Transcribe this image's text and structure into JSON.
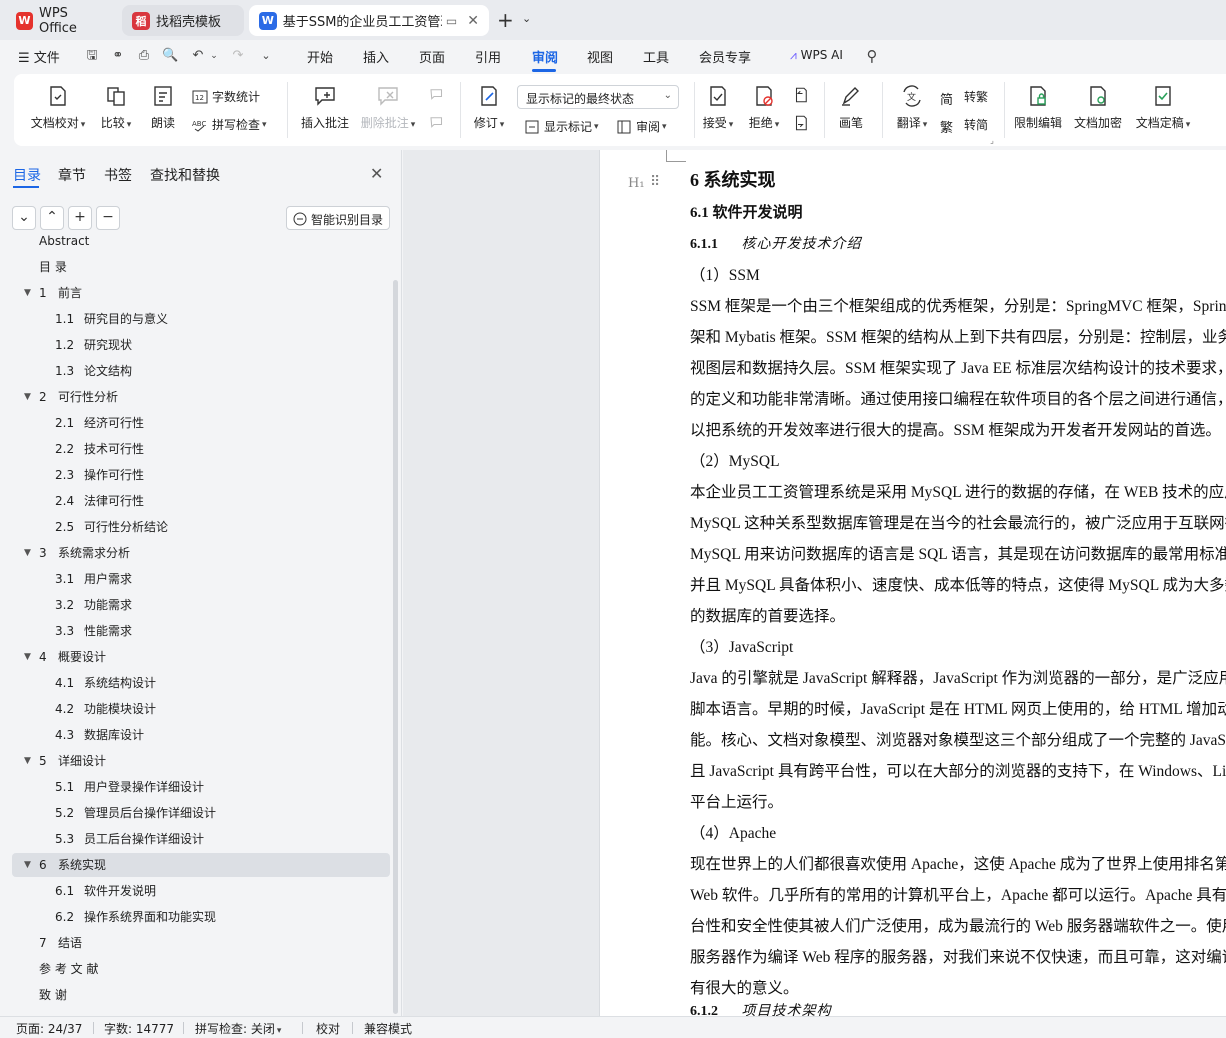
{
  "tabs": {
    "wps_office": "WPS Office",
    "template": "找稻壳模板",
    "document": "基于SSM的企业员工工资管理系统"
  },
  "menu": {
    "file": "文件",
    "items": [
      "开始",
      "插入",
      "页面",
      "引用",
      "审阅",
      "视图",
      "工具",
      "会员专享"
    ],
    "active": "审阅",
    "wps_ai": "WPS AI"
  },
  "ribbon": {
    "doc_check": "文档校对",
    "compare": "比较",
    "read_aloud": "朗读",
    "word_count": "字数统计",
    "spell_check": "拼写检查",
    "insert_comment": "插入批注",
    "delete_comment": "删除批注",
    "track_changes": "修订",
    "markup_state": "显示标记的最终状态",
    "show_markup": "显示标记",
    "review_pane": "审阅",
    "accept": "接受",
    "reject": "拒绝",
    "pen": "画笔",
    "translate": "翻译",
    "to_traditional": "转繁",
    "to_simplified": "转简",
    "restrict_edit": "限制编辑",
    "encrypt": "文档加密",
    "finalize": "文档定稿"
  },
  "nav": {
    "tabs": [
      "目录",
      "章节",
      "书签",
      "查找和替换"
    ],
    "smart_toc": "智能识别目录",
    "toc": [
      {
        "num": "",
        "text": "Abstract",
        "level": 0
      },
      {
        "num": "",
        "text": "目        录",
        "level": 0
      },
      {
        "num": "1",
        "text": "前言",
        "level": 1
      },
      {
        "num": "1.1",
        "text": "研究目的与意义",
        "level": 2
      },
      {
        "num": "1.2",
        "text": "研究现状",
        "level": 2
      },
      {
        "num": "1.3",
        "text": "论文结构",
        "level": 2
      },
      {
        "num": "2",
        "text": "可行性分析",
        "level": 1
      },
      {
        "num": "2.1",
        "text": "经济可行性",
        "level": 2
      },
      {
        "num": "2.2",
        "text": "技术可行性",
        "level": 2
      },
      {
        "num": "2.3",
        "text": "操作可行性",
        "level": 2
      },
      {
        "num": "2.4",
        "text": "法律可行性",
        "level": 2
      },
      {
        "num": "2.5",
        "text": "可行性分析结论",
        "level": 2
      },
      {
        "num": "3",
        "text": "系统需求分析",
        "level": 1
      },
      {
        "num": "3.1",
        "text": "用户需求",
        "level": 2
      },
      {
        "num": "3.2",
        "text": "功能需求",
        "level": 2
      },
      {
        "num": "3.3",
        "text": "性能需求",
        "level": 2
      },
      {
        "num": "4",
        "text": "概要设计",
        "level": 1
      },
      {
        "num": "4.1",
        "text": "系统结构设计",
        "level": 2
      },
      {
        "num": "4.2",
        "text": "功能模块设计",
        "level": 2
      },
      {
        "num": "4.3",
        "text": "数据库设计",
        "level": 2
      },
      {
        "num": "5",
        "text": "详细设计",
        "level": 1
      },
      {
        "num": "5.1",
        "text": "用户登录操作详细设计",
        "level": 2
      },
      {
        "num": "5.2",
        "text": "管理员后台操作详细设计",
        "level": 2
      },
      {
        "num": "5.3",
        "text": "员工后台操作详细设计",
        "level": 2
      },
      {
        "num": "6",
        "text": "系统实现",
        "level": 1,
        "selected": true
      },
      {
        "num": "6.1",
        "text": "软件开发说明",
        "level": 2
      },
      {
        "num": "6.2",
        "text": "操作系统界面和功能实现",
        "level": 2
      },
      {
        "num": "7",
        "text": "结语",
        "level": 0
      },
      {
        "num": "",
        "text": "参  考  文  献",
        "level": 0
      },
      {
        "num": "",
        "text": "致          谢",
        "level": 0
      }
    ]
  },
  "document": {
    "h1": "6     系统实现",
    "h2": "6.1     软件开发说明",
    "h3_num": "6.1.1",
    "h3_text": "核心开发技术介绍",
    "lines": [
      {
        "type": "sub",
        "text": "（1）SSM"
      },
      {
        "type": "p",
        "text": "    SSM 框架是一个由三个框架组成的优秀框架，分别是：SpringMVC 框架，Spring 框"
      },
      {
        "type": "p",
        "text": "架和 Mybatis 框架。SSM 框架的结构从上到下共有四层，分别是：控制层，业务逻辑层，"
      },
      {
        "type": "p",
        "text": "视图层和数据持久层。SSM 框架实现了 Java EE 标准层次结构设计的技术要求，每一层"
      },
      {
        "type": "p",
        "text": "的定义和功能非常清晰。通过使用接口编程在软件项目的各个层之间进行通信，可"
      },
      {
        "type": "p",
        "text": "以把系统的开发效率进行很大的提高。SSM 框架成为开发者开发网站的首选。"
      },
      {
        "type": "sub",
        "text": "（2）MySQL"
      },
      {
        "type": "p",
        "text": "    本企业员工工资管理系统是采用 MySQL 进行的数据的存储，在 WEB 技术的应用中，"
      },
      {
        "type": "p",
        "text": "MySQL 这种关系型数据库管理是在当今的社会最流行的，被广泛应用于互联网行业，"
      },
      {
        "type": "p",
        "text": "MySQL 用来访问数据库的语言是 SQL 语言，其是现在访问数据库的最常用标准化语言，"
      },
      {
        "type": "p",
        "text": "并且 MySQL 具备体积小、速度快、成本低等的特点，这使得 MySQL 成为大多数网站"
      },
      {
        "type": "p",
        "text": "的数据库的首要选择。"
      },
      {
        "type": "sub",
        "text": "（3）JavaScript"
      },
      {
        "type": "p",
        "text": "    Java 的引擎就是 JavaScript 解释器，JavaScript 作为浏览器的一部分，是广泛应用的"
      },
      {
        "type": "p",
        "text": "脚本语言。早期的时候，JavaScript 是在 HTML 网页上使用的，给 HTML 增加动态功"
      },
      {
        "type": "p",
        "text": "能。核心、文档对象模型、浏览器对象模型这三个部分组成了一个完整的 JavaScript，并"
      },
      {
        "type": "p",
        "text": "且 JavaScript 具有跨平台性，可以在大部分的浏览器的支持下，在 Windows、Linux 等"
      },
      {
        "type": "p",
        "text": "平台上运行。"
      },
      {
        "type": "sub",
        "text": "（4）Apache"
      },
      {
        "type": "p",
        "text": "    现在世界上的人们都很喜欢使用 Apache，这使 Apache 成为了世界上使用排名第一的"
      },
      {
        "type": "p",
        "text": "Web 软件。几乎所有的常用的计算机平台上，Apache 都可以运行。Apache 具有的跨平"
      },
      {
        "type": "p",
        "text": "台性和安全性使其被人们广泛使用，成为最流行的 Web 服务器端软件之一。使用 Apache"
      },
      {
        "type": "p",
        "text": "服务器作为编译 Web 程序的服务器，对我们来说不仅快速，而且可靠，这对编译程序"
      },
      {
        "type": "p",
        "text": "有很大的意义。"
      }
    ],
    "h3b_num": "6.1.2",
    "h3b_text": "项目技术架构"
  },
  "status": {
    "page": "页面: 24/37",
    "words": "字数: 14777",
    "spell": "拼写检查: 关闭",
    "proof": "校对",
    "compat": "兼容模式"
  },
  "colors": {
    "accent": "#1c66e5",
    "wps_red": "#e5322d",
    "doc_blue": "#2b6be6"
  }
}
